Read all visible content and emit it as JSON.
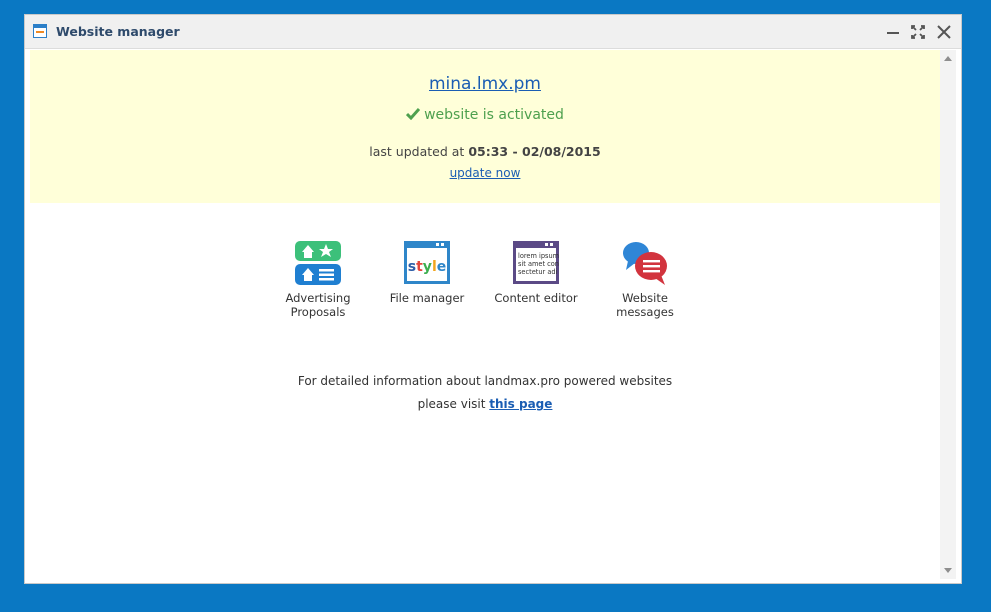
{
  "window": {
    "title": "Website manager",
    "icon": "website-manager-icon",
    "controls": [
      "minimize-icon",
      "maximize-icon",
      "close-icon"
    ]
  },
  "status": {
    "site": "mina.lmx.pm",
    "activated_text": "website is activated",
    "updated_prefix": "last updated at",
    "updated_time": "05:33 - 02/08/2015",
    "update_link": "update now"
  },
  "tools": [
    {
      "label": "Advertising Proposals",
      "icon": "advertising-proposals-icon"
    },
    {
      "label": "File manager",
      "icon": "file-manager-icon",
      "icon_text": "style"
    },
    {
      "label": "Content editor",
      "icon": "content-editor-icon",
      "icon_text": "lorem ipsum sit amet con sectetur adi"
    },
    {
      "label": "Website messages",
      "icon": "website-messages-icon"
    }
  ],
  "info": {
    "line1": "For detailed information about landmax.pro powered websites",
    "line2_prefix": "please visit",
    "link": "this page"
  },
  "colors": {
    "background": "#0a78c3",
    "status_panel": "#ffffd9",
    "link": "#1a5db3",
    "success": "#4ea04e"
  }
}
